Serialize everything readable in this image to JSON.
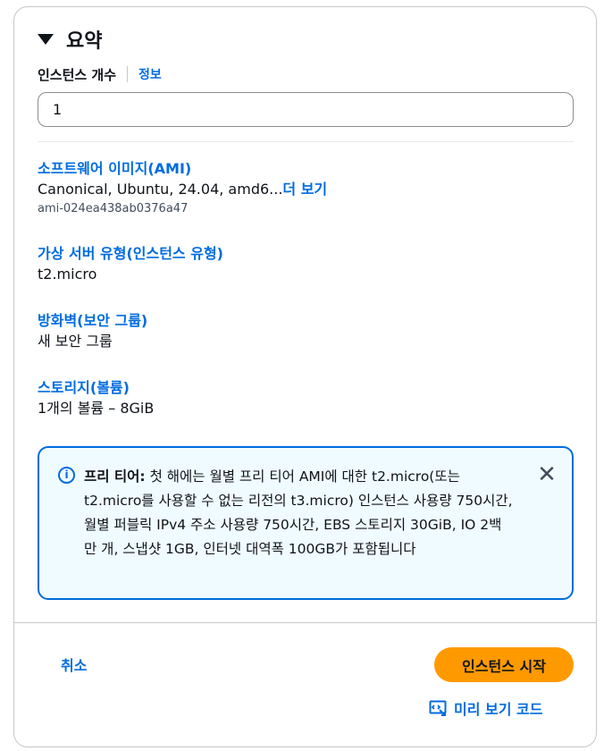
{
  "summary": {
    "title": "요약",
    "instance_count": {
      "label": "인스턴스 개수",
      "info_link": "정보",
      "value": "1"
    },
    "ami": {
      "title": "소프트웨어 이미지(AMI)",
      "value": "Canonical, Ubuntu, 24.04, amd6...",
      "more_link": "더 보기",
      "ami_id": "ami-024ea438ab0376a47"
    },
    "instance_type": {
      "title": "가상 서버 유형(인스턴스 유형)",
      "value": "t2.micro"
    },
    "firewall": {
      "title": "방화벽(보안 그룹)",
      "value": "새 보안 그룹"
    },
    "storage": {
      "title": "스토리지(볼륨)",
      "value": "1개의 볼륨 – 8GiB"
    },
    "free_tier_alert": {
      "icon": "info-icon",
      "heading": "프리 티어:",
      "body": "첫 해에는 월별 프리 티어 AMI에 대한 t2.micro(또는 t2.micro를 사용할 수 없는 리전의 t3.micro) 인스턴스 사용량 750시간, 월별 퍼블릭 IPv4 주소 사용량 750시간, EBS 스토리지 30GiB, IO 2백만 개, 스냅샷 1GB, 인터넷 대역폭 100GB가 포함됩니다",
      "close_icon": "close-icon"
    },
    "actions": {
      "cancel_label": "취소",
      "launch_label": "인스턴스 시작",
      "preview_label": "미리 보기 코드"
    },
    "colors": {
      "link": "#006ce0",
      "primary_button": "#ff9900",
      "alert_bg": "#f0fbff"
    }
  }
}
